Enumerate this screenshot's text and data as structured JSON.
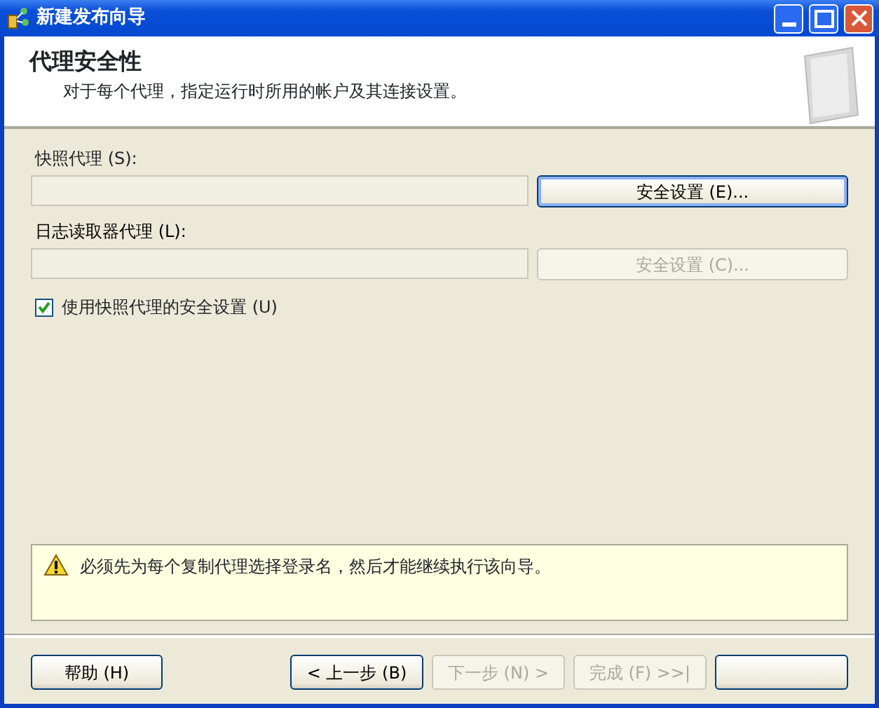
{
  "window": {
    "title": "新建发布向导"
  },
  "header": {
    "title": "代理安全性",
    "subtitle": "对于每个代理，指定运行时所用的帐户及其连接设置。"
  },
  "agents": [
    {
      "label": "快照代理 (S):",
      "button": "安全设置 (E)...",
      "disabled": false
    },
    {
      "label": "日志读取器代理 (L):",
      "button": "安全设置 (C)...",
      "disabled": true
    }
  ],
  "checkbox": {
    "label": "使用快照代理的安全设置 (U)",
    "checked": true
  },
  "message": {
    "text": "必须先为每个复制代理选择登录名，然后才能继续执行该向导。"
  },
  "buttons": [
    {
      "label": "帮助 (H)",
      "disabled": false,
      "kind": "left"
    },
    {
      "label": "< 上一步 (B)",
      "disabled": false,
      "kind": "right"
    },
    {
      "label": "下一步 (N) >",
      "disabled": true,
      "kind": "right"
    },
    {
      "label": "完成 (F) >>|",
      "disabled": true,
      "kind": "right"
    },
    {
      "disabled": false,
      "kind": "right"
    }
  ]
}
